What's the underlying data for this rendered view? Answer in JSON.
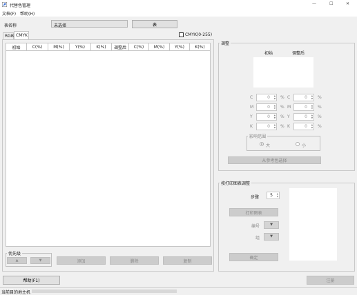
{
  "window": {
    "title": "代替色管理",
    "minimize_glyph": "—",
    "maximize_glyph": "☐",
    "close_glyph": "✕"
  },
  "menu": {
    "file": "文档(F)",
    "help": "帮助(H)"
  },
  "table_name": {
    "label": "表名称",
    "value": "未选择",
    "button": "表"
  },
  "tabs": {
    "rgb": "RGB",
    "cmyk": "CMYK"
  },
  "cmyk_range_label": "CMYK(0-255)",
  "table": {
    "columns": [
      "初始",
      "C(%)",
      "M(%)",
      "Y(%)",
      "K(%)",
      "调整后",
      "C(%)",
      "M(%)",
      "Y(%)",
      "K(%)"
    ]
  },
  "priority": {
    "label": "优先级",
    "up": "▲",
    "down": "▼"
  },
  "table_buttons": {
    "add": "添加",
    "delete": "删除",
    "copy": "复制"
  },
  "adjust": {
    "title": "调整",
    "initial": "初始",
    "adjusted": "调整后",
    "rows": [
      {
        "label": "C",
        "left": "0",
        "right": "0"
      },
      {
        "label": "M",
        "left": "0",
        "right": "0"
      },
      {
        "label": "Y",
        "left": "0",
        "right": "0"
      },
      {
        "label": "K",
        "left": "0",
        "right": "0"
      }
    ],
    "percent": "%",
    "range": {
      "title": "影响范围",
      "large": "大",
      "small": "小"
    },
    "select_from_reference": "从参考色选择"
  },
  "print_chart": {
    "title": "按打印图表调整",
    "step_label": "步骤",
    "step_value": "5",
    "print_button": "打印图表",
    "number_label": "编号",
    "group_label": "组",
    "confirm_button": "确定"
  },
  "footer": {
    "help_button": "帮助(F1)",
    "register_button": "注册"
  },
  "status": {
    "label": "当前目的地主机"
  }
}
